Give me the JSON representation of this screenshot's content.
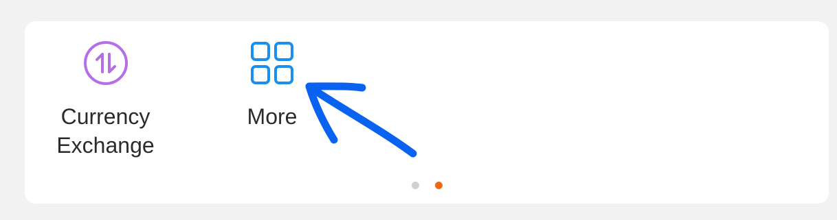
{
  "shortcuts": [
    {
      "label": "Currency\nExchange",
      "icon": "currency-exchange-icon",
      "color": "#b46ee6"
    },
    {
      "label": "More",
      "icon": "grid-icon",
      "color": "#1a8ff0"
    }
  ],
  "pagination": {
    "page_count": 2,
    "active_page": 2,
    "inactive_color": "#d0d0d0",
    "active_color": "#f26a10"
  },
  "annotation": {
    "icon": "arrow-annotation-icon",
    "color": "#0a62f0"
  }
}
